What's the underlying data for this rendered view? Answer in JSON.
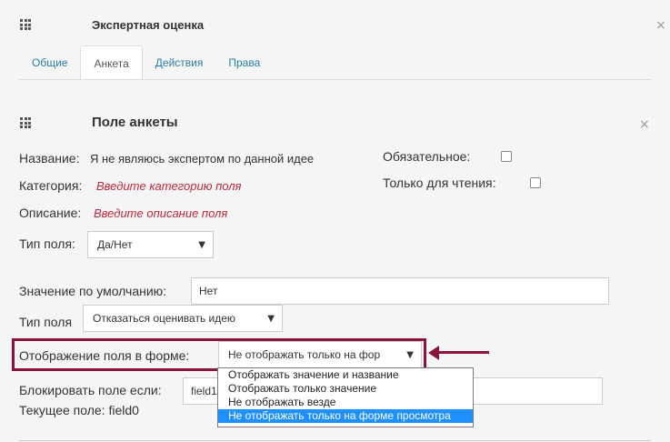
{
  "window": {
    "title": "Экспертная оценка",
    "close": "×"
  },
  "tabs": [
    {
      "label": "Общие",
      "active": false
    },
    {
      "label": "Анкета",
      "active": true
    },
    {
      "label": "Действия",
      "active": false
    },
    {
      "label": "Права",
      "active": false
    }
  ],
  "field_panel": {
    "title": "Поле анкеты",
    "close": "×",
    "name_label": "Название:",
    "name_value": "Я не являюсь экспертом по данной идее",
    "category_label": "Категория:",
    "category_placeholder": "Введите категорию поля",
    "description_label": "Описание:",
    "description_placeholder": "Введите описание поля",
    "required_label": "Обязательное:",
    "required_checked": false,
    "readonly_label": "Только для чтения:",
    "readonly_checked": false,
    "field_type_label": "Тип поля:",
    "field_type_value": "Да/Нет",
    "default_label": "Значение по умолчанию:",
    "default_value": "Нет",
    "type2_label": "Тип поля",
    "type2_value": "Отказаться оценивать идею",
    "display_label": "Отображение поля в форме:",
    "display_value": "Не отображать только на фор",
    "block_label": "Блокировать поле если:",
    "block_value": "field1",
    "current_field_label": "Текущее поле: field0"
  },
  "display_options": [
    {
      "label": "Отображать значение и название",
      "selected": false
    },
    {
      "label": "Отображать только значение",
      "selected": false
    },
    {
      "label": "Не отображать везде",
      "selected": false
    },
    {
      "label": "Не отображать только на форме просмотра",
      "selected": true
    }
  ],
  "colors": {
    "accent": "#2a7da8",
    "placeholder": "#c0273a",
    "highlight": "#8b1538",
    "selected": "#1e90ff"
  }
}
